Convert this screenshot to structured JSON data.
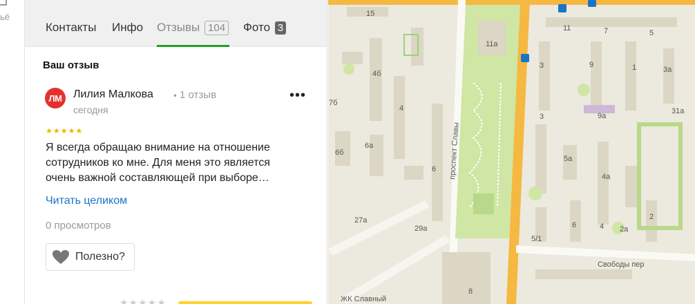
{
  "sidebar_fragment": {
    "text": "ьё"
  },
  "tabs": [
    {
      "label": "Контакты",
      "active": false
    },
    {
      "label": "Инфо",
      "active": false
    },
    {
      "label": "Отзывы",
      "count": "104",
      "active": true
    },
    {
      "label": "Фото",
      "count": "3",
      "active": false
    }
  ],
  "section_title": "Ваш отзыв",
  "review": {
    "avatar_initials": "ЛМ",
    "author": "Лилия Малкова",
    "author_meta": "1 отзыв",
    "date": "сегодня",
    "rating": 5,
    "stars": "★★★★★",
    "text": "Я всегда обращаю внимание на отношение сотрудников ко мне. Для меня это является очень важной составляющей при выборе…",
    "read_more": "Читать целиком",
    "views": "0 просмотров",
    "useful_label": "Полезно?",
    "more_glyph": "•••"
  },
  "bottom": {
    "stars": "★★★★★"
  },
  "map": {
    "street_labels": [
      "проспект Славы",
      "Свободы пер"
    ],
    "poi_label": "ЖК Славный",
    "building_numbers": [
      "15",
      "11",
      "7",
      "5",
      "11а",
      "4б",
      "3",
      "9",
      "1",
      "3а",
      "7б",
      "4",
      "9а",
      "31а",
      "6б",
      "6а",
      "3",
      "5а",
      "6",
      "4а",
      "2",
      "27а",
      "29а",
      "6",
      "4",
      "5/1",
      "2а",
      "8"
    ],
    "colors": {
      "background": "#ece9de",
      "main_road": "#f5b841",
      "park": "#cfe6a4",
      "buildings": "#dcd6c4"
    }
  }
}
